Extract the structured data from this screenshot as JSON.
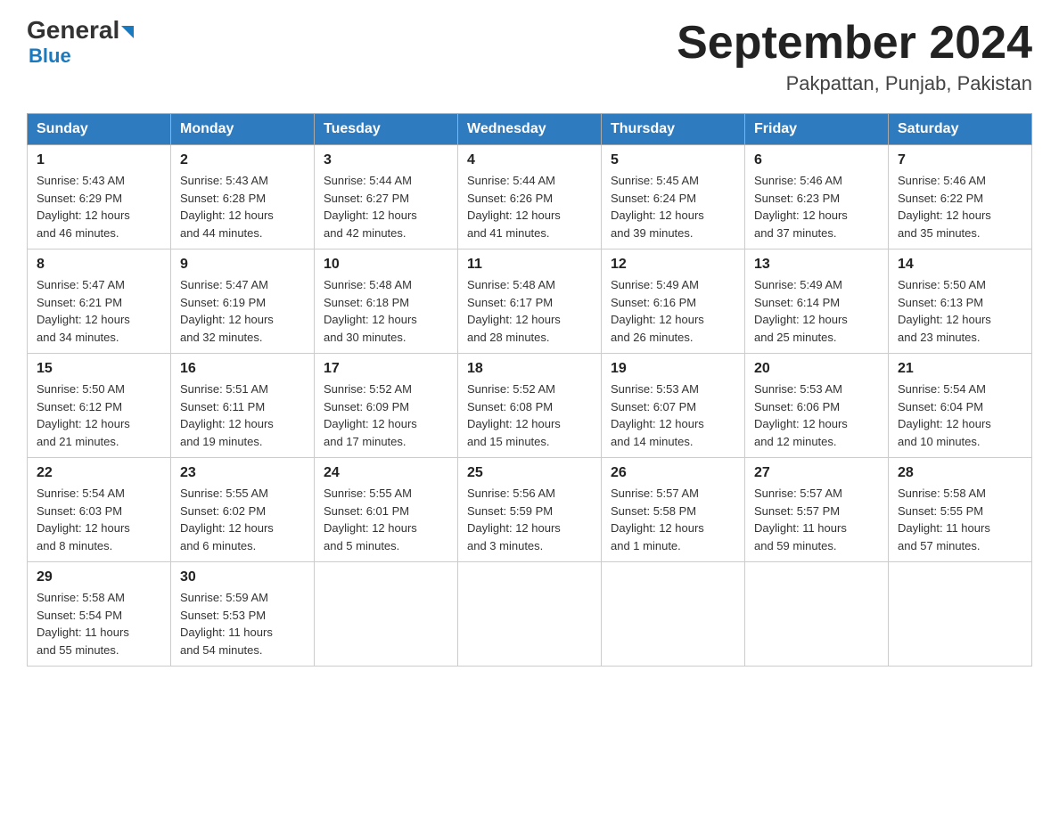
{
  "header": {
    "logo_general": "General",
    "logo_blue": "Blue",
    "month_title": "September 2024",
    "location": "Pakpattan, Punjab, Pakistan"
  },
  "weekdays": [
    "Sunday",
    "Monday",
    "Tuesday",
    "Wednesday",
    "Thursday",
    "Friday",
    "Saturday"
  ],
  "weeks": [
    [
      {
        "day": "1",
        "sunrise": "5:43 AM",
        "sunset": "6:29 PM",
        "daylight": "12 hours and 46 minutes."
      },
      {
        "day": "2",
        "sunrise": "5:43 AM",
        "sunset": "6:28 PM",
        "daylight": "12 hours and 44 minutes."
      },
      {
        "day": "3",
        "sunrise": "5:44 AM",
        "sunset": "6:27 PM",
        "daylight": "12 hours and 42 minutes."
      },
      {
        "day": "4",
        "sunrise": "5:44 AM",
        "sunset": "6:26 PM",
        "daylight": "12 hours and 41 minutes."
      },
      {
        "day": "5",
        "sunrise": "5:45 AM",
        "sunset": "6:24 PM",
        "daylight": "12 hours and 39 minutes."
      },
      {
        "day": "6",
        "sunrise": "5:46 AM",
        "sunset": "6:23 PM",
        "daylight": "12 hours and 37 minutes."
      },
      {
        "day": "7",
        "sunrise": "5:46 AM",
        "sunset": "6:22 PM",
        "daylight": "12 hours and 35 minutes."
      }
    ],
    [
      {
        "day": "8",
        "sunrise": "5:47 AM",
        "sunset": "6:21 PM",
        "daylight": "12 hours and 34 minutes."
      },
      {
        "day": "9",
        "sunrise": "5:47 AM",
        "sunset": "6:19 PM",
        "daylight": "12 hours and 32 minutes."
      },
      {
        "day": "10",
        "sunrise": "5:48 AM",
        "sunset": "6:18 PM",
        "daylight": "12 hours and 30 minutes."
      },
      {
        "day": "11",
        "sunrise": "5:48 AM",
        "sunset": "6:17 PM",
        "daylight": "12 hours and 28 minutes."
      },
      {
        "day": "12",
        "sunrise": "5:49 AM",
        "sunset": "6:16 PM",
        "daylight": "12 hours and 26 minutes."
      },
      {
        "day": "13",
        "sunrise": "5:49 AM",
        "sunset": "6:14 PM",
        "daylight": "12 hours and 25 minutes."
      },
      {
        "day": "14",
        "sunrise": "5:50 AM",
        "sunset": "6:13 PM",
        "daylight": "12 hours and 23 minutes."
      }
    ],
    [
      {
        "day": "15",
        "sunrise": "5:50 AM",
        "sunset": "6:12 PM",
        "daylight": "12 hours and 21 minutes."
      },
      {
        "day": "16",
        "sunrise": "5:51 AM",
        "sunset": "6:11 PM",
        "daylight": "12 hours and 19 minutes."
      },
      {
        "day": "17",
        "sunrise": "5:52 AM",
        "sunset": "6:09 PM",
        "daylight": "12 hours and 17 minutes."
      },
      {
        "day": "18",
        "sunrise": "5:52 AM",
        "sunset": "6:08 PM",
        "daylight": "12 hours and 15 minutes."
      },
      {
        "day": "19",
        "sunrise": "5:53 AM",
        "sunset": "6:07 PM",
        "daylight": "12 hours and 14 minutes."
      },
      {
        "day": "20",
        "sunrise": "5:53 AM",
        "sunset": "6:06 PM",
        "daylight": "12 hours and 12 minutes."
      },
      {
        "day": "21",
        "sunrise": "5:54 AM",
        "sunset": "6:04 PM",
        "daylight": "12 hours and 10 minutes."
      }
    ],
    [
      {
        "day": "22",
        "sunrise": "5:54 AM",
        "sunset": "6:03 PM",
        "daylight": "12 hours and 8 minutes."
      },
      {
        "day": "23",
        "sunrise": "5:55 AM",
        "sunset": "6:02 PM",
        "daylight": "12 hours and 6 minutes."
      },
      {
        "day": "24",
        "sunrise": "5:55 AM",
        "sunset": "6:01 PM",
        "daylight": "12 hours and 5 minutes."
      },
      {
        "day": "25",
        "sunrise": "5:56 AM",
        "sunset": "5:59 PM",
        "daylight": "12 hours and 3 minutes."
      },
      {
        "day": "26",
        "sunrise": "5:57 AM",
        "sunset": "5:58 PM",
        "daylight": "12 hours and 1 minute."
      },
      {
        "day": "27",
        "sunrise": "5:57 AM",
        "sunset": "5:57 PM",
        "daylight": "11 hours and 59 minutes."
      },
      {
        "day": "28",
        "sunrise": "5:58 AM",
        "sunset": "5:55 PM",
        "daylight": "11 hours and 57 minutes."
      }
    ],
    [
      {
        "day": "29",
        "sunrise": "5:58 AM",
        "sunset": "5:54 PM",
        "daylight": "11 hours and 55 minutes."
      },
      {
        "day": "30",
        "sunrise": "5:59 AM",
        "sunset": "5:53 PM",
        "daylight": "11 hours and 54 minutes."
      },
      null,
      null,
      null,
      null,
      null
    ]
  ],
  "labels": {
    "sunrise": "Sunrise:",
    "sunset": "Sunset:",
    "daylight": "Daylight:"
  }
}
